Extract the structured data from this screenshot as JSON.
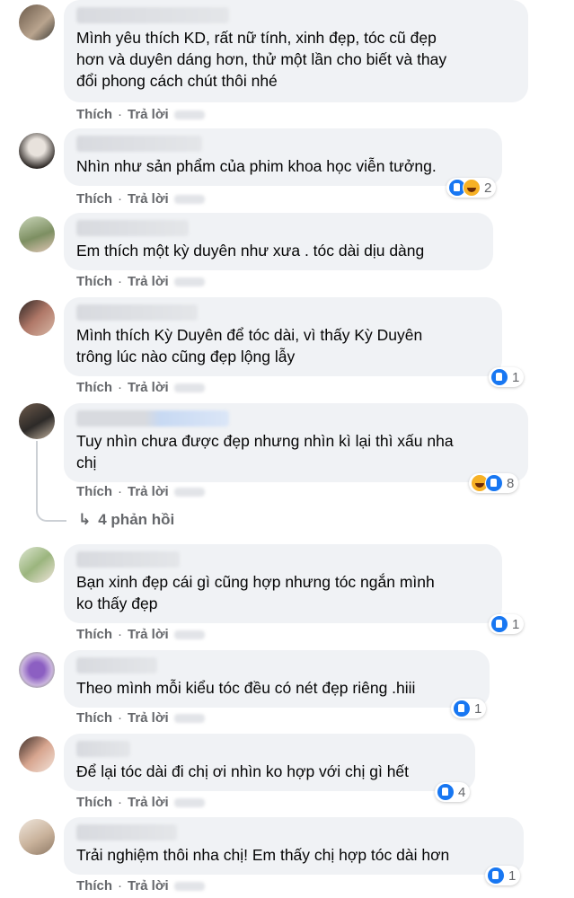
{
  "comments": [
    {
      "text": "Mình yêu thích KD, rất nữ tính, xinh đẹp, tóc cũ đẹp\nhơn và duyên dáng hơn, thử một lần cho biết và thay\nđổi phong cách chút thôi nhé",
      "like": "Thích",
      "reply": "Trả lời"
    },
    {
      "text": "Nhìn như sản phẩm của phim khoa học viễn tưởng.",
      "like": "Thích",
      "reply": "Trả lời",
      "reaction_count": "2"
    },
    {
      "text": "Em thích một kỳ duyên như xưa . tóc dài dịu dàng",
      "like": "Thích",
      "reply": "Trả lời"
    },
    {
      "text": "Mình thích Kỳ Duyên để tóc dài, vì thấy Kỳ Duyên\ntrông lúc nào cũng đẹp lộng lẫy",
      "like": "Thích",
      "reply": "Trả lời",
      "reaction_count": "1"
    },
    {
      "text": "Tuy nhìn chưa được đẹp nhưng nhìn kì lại thì xấu nha\nchị",
      "like": "Thích",
      "reply": "Trả lời",
      "reaction_count": "8"
    },
    {
      "text": "Bạn xinh đẹp cái gì cũng hợp nhưng tóc ngắn mình\nko thấy đẹp",
      "like": "Thích",
      "reply": "Trả lời",
      "reaction_count": "1"
    },
    {
      "text": "Theo mình mỗi kiểu tóc đều có nét đẹp riêng .hiii",
      "like": "Thích",
      "reply": "Trả lời",
      "reaction_count": "1"
    },
    {
      "text": "Để lại tóc dài đi chị ơi nhìn ko hợp với chị gì hết",
      "like": "Thích",
      "reply": "Trả lời",
      "reaction_count": "4"
    },
    {
      "text": "Trải nghiệm thôi nha chị! Em thấy chị hợp tóc dài hơn",
      "like": "Thích",
      "reply": "Trả lời",
      "reaction_count": "1"
    }
  ],
  "replies_link": {
    "arrow": "↳",
    "label": "4 phản hồi"
  },
  "colors": {
    "bubble": "#f0f2f5",
    "meta": "#65676b",
    "like_blue": "#1877f2",
    "haha_yellow": "#f7b125"
  }
}
